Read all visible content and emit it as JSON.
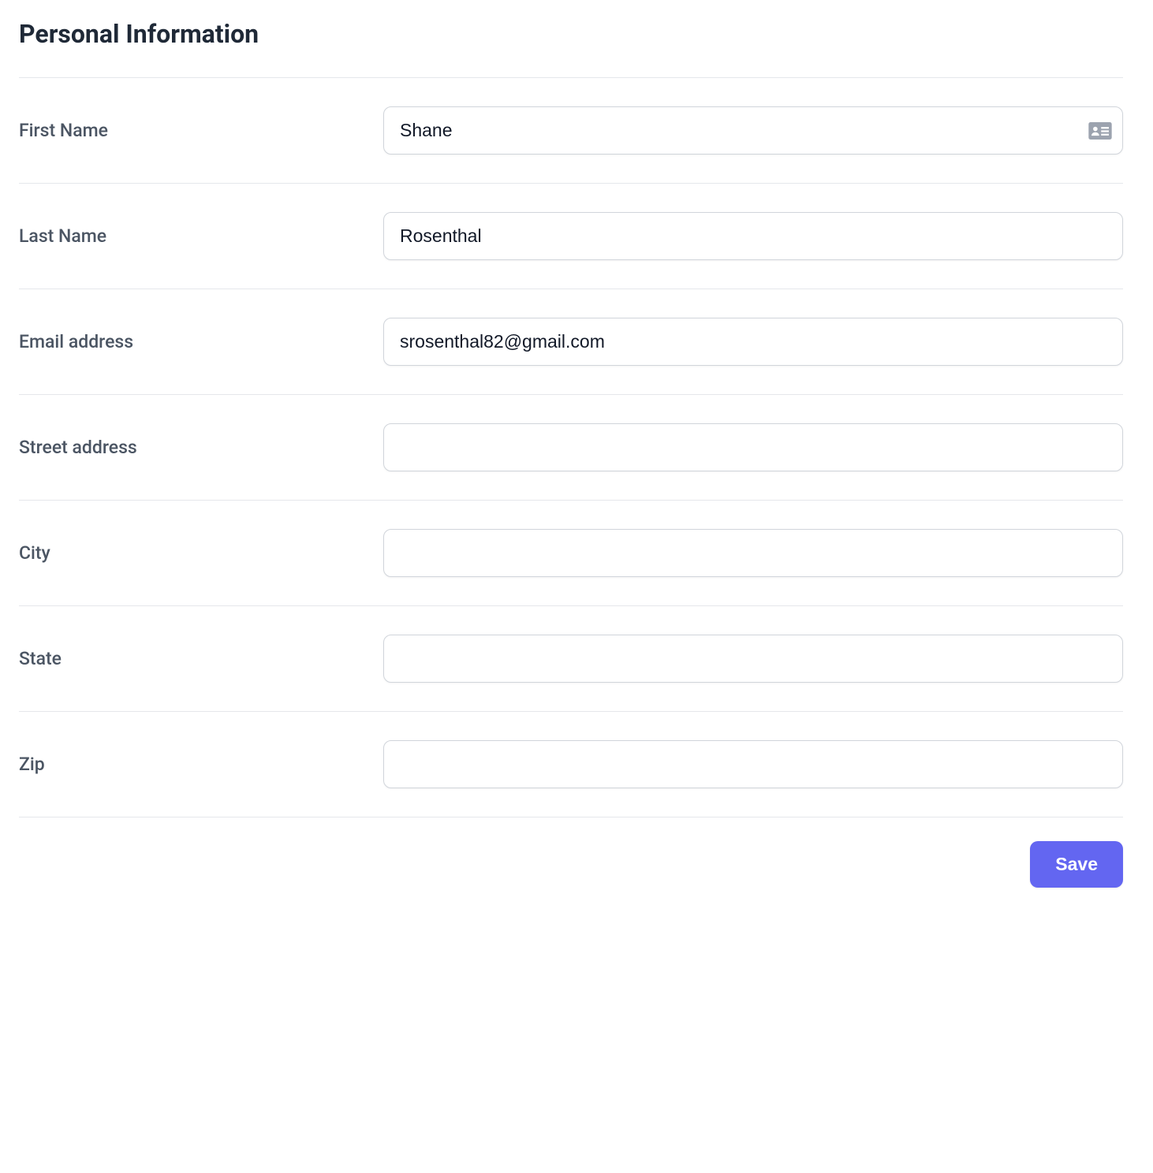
{
  "heading": "Personal Information",
  "fields": {
    "first_name": {
      "label": "First Name",
      "value": "Shane"
    },
    "last_name": {
      "label": "Last Name",
      "value": "Rosenthal"
    },
    "email": {
      "label": "Email address",
      "value": "srosenthal82@gmail.com"
    },
    "street": {
      "label": "Street address",
      "value": ""
    },
    "city": {
      "label": "City",
      "value": ""
    },
    "state": {
      "label": "State",
      "value": ""
    },
    "zip": {
      "label": "Zip",
      "value": ""
    }
  },
  "actions": {
    "save_label": "Save"
  }
}
